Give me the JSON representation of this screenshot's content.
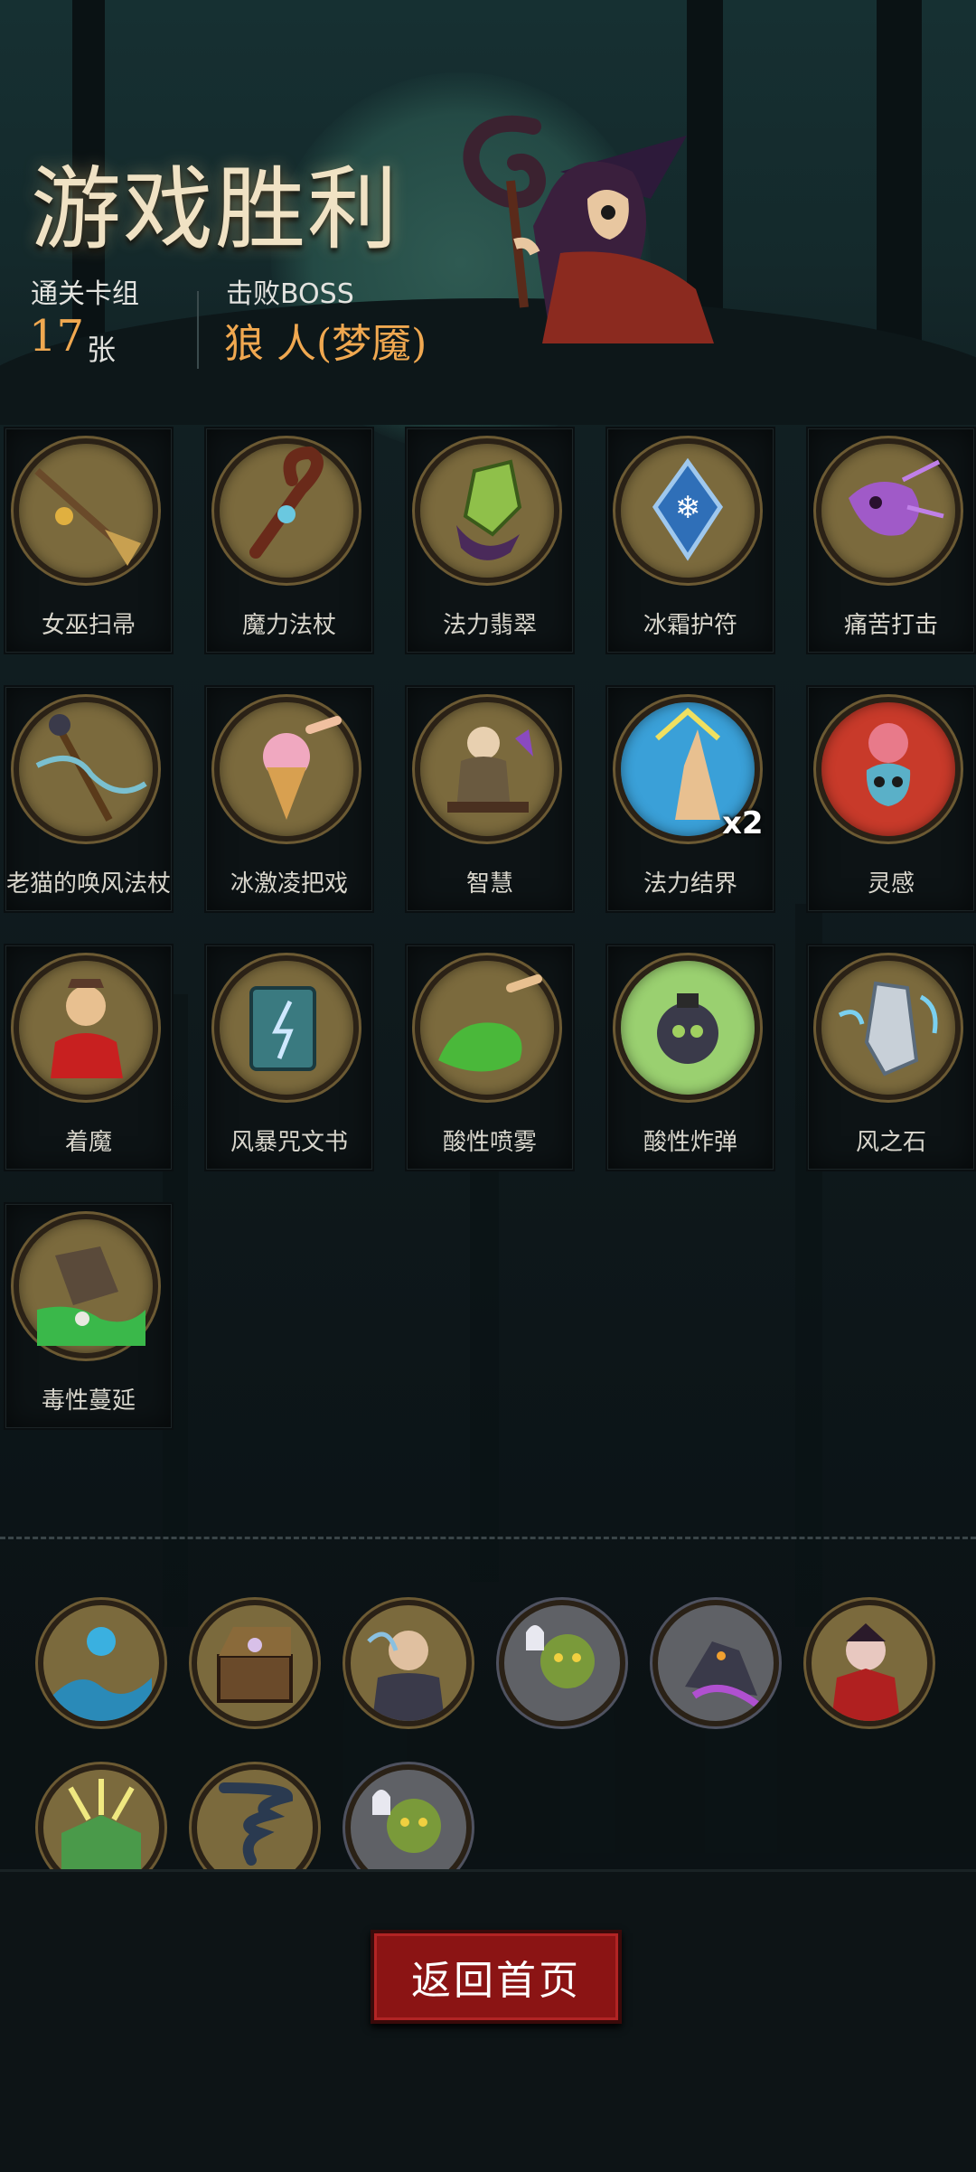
{
  "header": {
    "title": "游戏胜利",
    "deck_label": "通关卡组",
    "deck_count": "17",
    "deck_unit": "张",
    "boss_label": "击败BOSS",
    "boss_name": "狼 人(梦魇)"
  },
  "cards": [
    {
      "name": "女巫扫帚",
      "icon": "broom-icon"
    },
    {
      "name": "魔力法杖",
      "icon": "staff-icon"
    },
    {
      "name": "法力翡翠",
      "icon": "crystal-icon"
    },
    {
      "name": "冰霜护符",
      "icon": "frost-amulet-icon"
    },
    {
      "name": "痛苦打击",
      "icon": "skull-strike-icon"
    },
    {
      "name": "老猫的唤风法杖",
      "icon": "wind-staff-icon"
    },
    {
      "name": "冰激凌把戏",
      "icon": "ice-cream-icon"
    },
    {
      "name": "智慧",
      "icon": "sage-icon"
    },
    {
      "name": "法力结界",
      "icon": "barrier-hand-icon",
      "badge": "x2"
    },
    {
      "name": "灵感",
      "icon": "brain-skull-icon"
    },
    {
      "name": "着魔",
      "icon": "possessed-icon"
    },
    {
      "name": "风暴咒文书",
      "icon": "spellbook-icon"
    },
    {
      "name": "酸性喷雾",
      "icon": "acid-spray-icon"
    },
    {
      "name": "酸性炸弹",
      "icon": "acid-bomb-icon"
    },
    {
      "name": "风之石",
      "icon": "wind-stone-icon"
    },
    {
      "name": "毒性蔓延",
      "icon": "poison-spread-icon"
    }
  ],
  "relics": [
    {
      "icon": "water-orb-icon"
    },
    {
      "icon": "music-box-icon"
    },
    {
      "icon": "old-sailor-icon"
    },
    {
      "icon": "goblin-ghost-icon"
    },
    {
      "icon": "shadow-beast-icon"
    },
    {
      "icon": "vampire-icon"
    },
    {
      "icon": "glowing-book-icon"
    },
    {
      "icon": "tornado-icon"
    },
    {
      "icon": "goblin-ghost-icon"
    }
  ],
  "footer": {
    "home_label": "返回首页"
  }
}
